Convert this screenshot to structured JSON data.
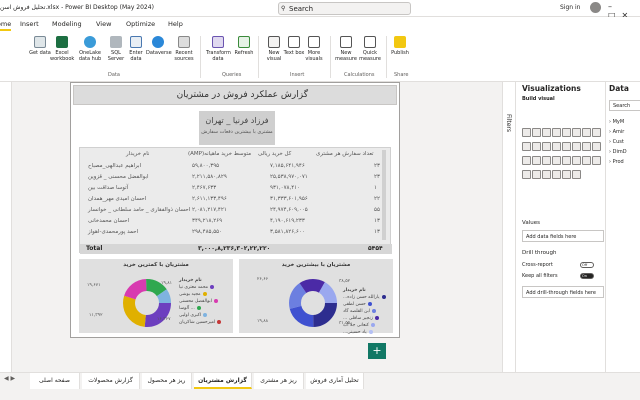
{
  "window": {
    "title": "تحلیل فروش اسن.xlsx - Power BI Desktop (May 2024)",
    "search_placeholder": "Search",
    "sign_in": "Sign in"
  },
  "menu_tabs": [
    "Home",
    "Insert",
    "Modeling",
    "View",
    "Optimize",
    "Help"
  ],
  "ribbon": {
    "buttons": [
      "Get data",
      "Excel workbook",
      "OneLake data hub",
      "SQL Server",
      "Enter data",
      "Dataverse",
      "Recent sources",
      "Transform data",
      "Refresh",
      "New visual",
      "Text box",
      "More visuals",
      "New measure",
      "Quick measure",
      "Publish"
    ],
    "groups": [
      "Data",
      "Queries",
      "Insert",
      "Calculations",
      "Share"
    ]
  },
  "report": {
    "banner_title": "گزارش عملکرد فروش در مشتریان",
    "kpi_name": "فرزاد فرنیا _ تهران",
    "kpi_sub": "مشتری با بیشترین دفعات سفارش",
    "table": {
      "headers": [
        "تعداد سفارش هر مشتری",
        "کل خرید ریالی",
        "(AMP)متوسط خرید ماهیانه",
        "نام خریدار"
      ],
      "rows": [
        [
          "۲۳",
          "۷,۱۸۵,۶۴۱,۹۴۶",
          "۵۹,۸۰۰,۳۹۵",
          "ابراهیم عبدالهی_مصباح"
        ],
        [
          "۲۳",
          "۲۵,۵۳۸,۹۷۰,۰۷۱",
          "۲,۲۱۱,۵۸۰,۸۲۹",
          "ابوالفضل محسنی _ قزوین"
        ],
        [
          "۱",
          "۹۳۱,۰۷۸,۴۱۰",
          "۲,۴۶۷,۶۳۳",
          "آتوسا صداقت بین"
        ],
        [
          "۲۲",
          "۳۱,۳۳۳,۶۰۱,۹۵۶",
          "۲,۶۱۱,۱۳۳,۴۹۶",
          "احسان امیدی مهر_همدان"
        ],
        [
          "۵۵",
          "۲۴,۹۷۴,۶۰۹,۰۰۵",
          "۲,۰۸۱,۲۱۷,۴۲۱",
          "احسان ذوالفقاری _ حامد سلطانی _ خوانسار"
        ],
        [
          "۱۳",
          "۴,۱۹۰,۶۱۹,۲۳۳",
          "۳۴۹,۲۱۸,۲۶۹",
          "احسان محمدخانی"
        ],
        [
          "۱۳",
          "۳,۵۸۱,۸۲۶,۶۰۰",
          "۲۹۸,۴۸۵,۵۵۰",
          "احمد پورمحمدی-اهواز"
        ]
      ],
      "total_label": "Total",
      "total_orders": "۵۴۵۴",
      "total_value": "۳,۰۰۰,۸,۲۳۶,۳۰۲,۲۲,۲۲۰",
      "total_avg": "۳۶۰,۰۶۹,۳۶۱,۰۲۲"
    },
    "donut_left": {
      "title": "مشتریان با کمترین خرید",
      "legend_title": "نام خریدار",
      "items": [
        "محمد معتری نیا",
        "مجید بوشی",
        "ابوالفضل محسنی",
        "آلوسا ...",
        "اکبری اولیی",
        "امیرحسین شاکریان"
      ],
      "labels": [
        "۱۹,۶۷۱",
        "۱۱,۳۹۲",
        "۱۶,۳۶۷",
        "۱۹,۸۱"
      ],
      "colors": [
        "#6d3fbf",
        "#e0b000",
        "#d83bb0",
        "#2fa84f",
        "#7fb3e0",
        "#c43636"
      ]
    },
    "donut_right": {
      "title": "مشتریان با بیشترین خرید",
      "legend_title": "نام خریدار",
      "items": [
        "...یارالله حسن زاده",
        "حسن لطفی",
        "ابن القلصه گاد",
        "... زنجیر ساقلی",
        "کنعانی جلا آب",
        "...یاد حسینی"
      ],
      "labels": [
        "۲۶,۶۶",
        "۱۹,۸۸",
        "۳۱,۵۵",
        "۳۸,۵۲"
      ],
      "colors": [
        "#2d2d8f",
        "#3f51d0",
        "#6c7fe0",
        "#4b2aa6",
        "#9aa8ef",
        "#b4c0f5"
      ]
    }
  },
  "filters_label": "Filters",
  "viz_pane": {
    "title": "Visualizations",
    "build_visual": "Build visual",
    "values_label": "Values",
    "values_placeholder": "Add data fields here",
    "drill_label": "Drill through",
    "cross_report": "Cross-report",
    "cross_report_state": "Off",
    "keep_filters": "Keep all filters",
    "keep_filters_state": "On",
    "drill_placeholder": "Add drill-through fields here"
  },
  "data_pane": {
    "title": "Data",
    "search_placeholder": "Search",
    "items": [
      "MyM",
      "Amir",
      "Cust",
      "DimD",
      "Prod"
    ]
  },
  "page_tabs": [
    "صفحه اصلی",
    "گزارش محصولات",
    "ریز هر محصول",
    "گزارش مشتریان",
    "ریز هر مشتری",
    "تحلیل آماری فروش"
  ],
  "active_page": "گزارش مشتریان"
}
